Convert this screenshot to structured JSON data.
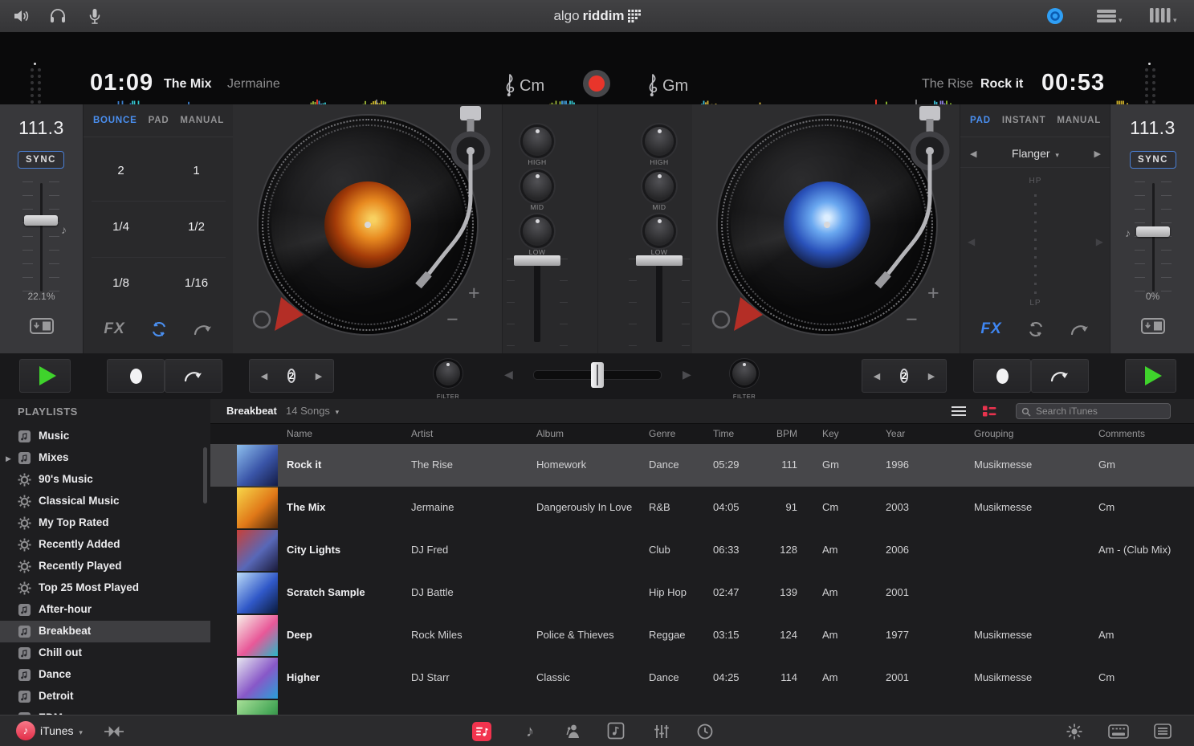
{
  "titlebar": {
    "logo_grey": "algo",
    "logo_white": "riddim"
  },
  "decks": {
    "left": {
      "time": "01:09",
      "title": "The Mix",
      "artist": "Jermaine",
      "key": "Cm"
    },
    "right": {
      "time": "00:53",
      "title": "Rock it",
      "artist": "The Rise",
      "key": "Gm"
    }
  },
  "tempo": {
    "left": {
      "bpm": "111.3",
      "sync_label": "SYNC",
      "percent": "22.1%"
    },
    "right": {
      "bpm": "111.3",
      "sync_label": "SYNC",
      "percent": "0%"
    }
  },
  "loop_panel": {
    "tabs": [
      "BOUNCE",
      "PAD",
      "MANUAL"
    ],
    "active_tab": "BOUNCE",
    "cells": [
      "2",
      "1",
      "1/4",
      "1/2",
      "1/8",
      "1/16"
    ],
    "fx_label": "FX"
  },
  "fx_panel": {
    "tabs": [
      "PAD",
      "INSTANT",
      "MANUAL"
    ],
    "active_tab": "PAD",
    "effect_name": "Flanger",
    "top_label": "HP",
    "bottom_label": "LP",
    "fx_label": "FX"
  },
  "mixer": {
    "eq_labels": [
      "HIGH",
      "MID",
      "LOW"
    ],
    "filter_label": "FILTER"
  },
  "transport": {
    "loop_value": "2"
  },
  "turntable": {
    "plus": "+",
    "minus": "−"
  },
  "playlists": {
    "header": "PLAYLISTS",
    "source_label": "iTunes",
    "items": [
      {
        "label": "Music",
        "icon": "playlist"
      },
      {
        "label": "Mixes",
        "icon": "playlist",
        "disclosure": true
      },
      {
        "label": "90's Music",
        "icon": "smart"
      },
      {
        "label": "Classical Music",
        "icon": "smart"
      },
      {
        "label": "My Top Rated",
        "icon": "smart"
      },
      {
        "label": "Recently Added",
        "icon": "smart"
      },
      {
        "label": "Recently Played",
        "icon": "smart"
      },
      {
        "label": "Top 25 Most Played",
        "icon": "smart"
      },
      {
        "label": "After-hour",
        "icon": "playlist"
      },
      {
        "label": "Breakbeat",
        "icon": "playlist",
        "selected": true
      },
      {
        "label": "Chill out",
        "icon": "playlist"
      },
      {
        "label": "Dance",
        "icon": "playlist"
      },
      {
        "label": "Detroit",
        "icon": "playlist"
      },
      {
        "label": "EDM",
        "icon": "playlist",
        "clipped": true
      }
    ]
  },
  "library": {
    "playlist_name": "Breakbeat",
    "count_label": "14 Songs",
    "search_placeholder": "Search iTunes",
    "columns": [
      "Name",
      "Artist",
      "Album",
      "Genre",
      "Time",
      "BPM",
      "Key",
      "Year",
      "Grouping",
      "Comments"
    ],
    "rows": [
      {
        "name": "Rock it",
        "artist": "The Rise",
        "album": "Homework",
        "genre": "Dance",
        "time": "05:29",
        "bpm": "111",
        "key": "Gm",
        "year": "1996",
        "grouping": "Musikmesse",
        "comments": "Gm",
        "selected": true,
        "art": [
          "#8ec0ee",
          "#3a55a8",
          "#141c46"
        ]
      },
      {
        "name": "The Mix",
        "artist": "Jermaine",
        "album": "Dangerously In Love",
        "genre": "R&B",
        "time": "04:05",
        "bpm": "91",
        "key": "Cm",
        "year": "2003",
        "grouping": "Musikmesse",
        "comments": "Cm",
        "art": [
          "#f8d84a",
          "#e07818",
          "#50280a"
        ]
      },
      {
        "name": "City Lights",
        "artist": "DJ Fred",
        "album": "",
        "genre": "Club",
        "time": "06:33",
        "bpm": "128",
        "key": "Am",
        "year": "2006",
        "grouping": "",
        "comments": "Am - (Club Mix)",
        "art": [
          "#c84038",
          "#5868b8",
          "#1a1a3a"
        ]
      },
      {
        "name": "Scratch Sample",
        "artist": "DJ Battle",
        "album": "",
        "genre": "Hip Hop",
        "time": "02:47",
        "bpm": "139",
        "key": "Am",
        "year": "2001",
        "grouping": "",
        "comments": "",
        "art": [
          "#bcdcf8",
          "#3058c8",
          "#0a1a3a"
        ]
      },
      {
        "name": "Deep",
        "artist": "Rock Miles",
        "album": "Police & Thieves",
        "genre": "Reggae",
        "time": "03:15",
        "bpm": "124",
        "key": "Am",
        "year": "1977",
        "grouping": "Musikmesse",
        "comments": "Am",
        "art": [
          "#f8f0e8",
          "#e85898",
          "#28b8c8"
        ]
      },
      {
        "name": "Higher",
        "artist": "DJ Starr",
        "album": "Classic",
        "genre": "Dance",
        "time": "04:25",
        "bpm": "114",
        "key": "Am",
        "year": "2001",
        "grouping": "Musikmesse",
        "comments": "Cm",
        "art": [
          "#e8e8f0",
          "#8858c8",
          "#28a0d8"
        ]
      },
      {
        "name": "",
        "artist": "",
        "album": "",
        "genre": "",
        "time": "",
        "bpm": "",
        "key": "",
        "year": "",
        "grouping": "",
        "comments": "",
        "partial": true,
        "art": [
          "#a8e098",
          "#48a858",
          "#1a5a2a"
        ]
      }
    ]
  },
  "colors": {
    "accent_blue": "#4a8ff0",
    "accent_red": "#e8352b",
    "accent_green": "#3fd32c",
    "itunes_red": "#ee4b5c"
  }
}
